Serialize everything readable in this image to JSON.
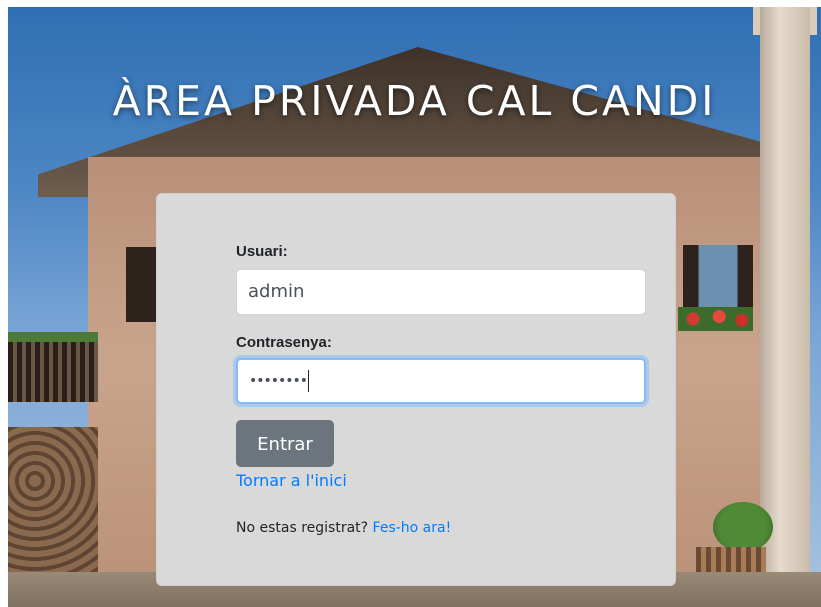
{
  "page": {
    "heading": "ÀREA PRIVADA CAL CANDI"
  },
  "login": {
    "user_label": "Usuari:",
    "user_value": "admin",
    "password_label": "Contrasenya:",
    "password_masked": "••••••••",
    "submit_label": "Entrar",
    "back_link": "Tornar a l'inici",
    "register_prompt": "No estas registrat?",
    "register_link": "Fes-ho ara!"
  },
  "colors": {
    "card_bg": "#d9d9d9",
    "button_bg": "#6c757d",
    "link": "#007bff",
    "focus_ring": "#80bdff"
  }
}
